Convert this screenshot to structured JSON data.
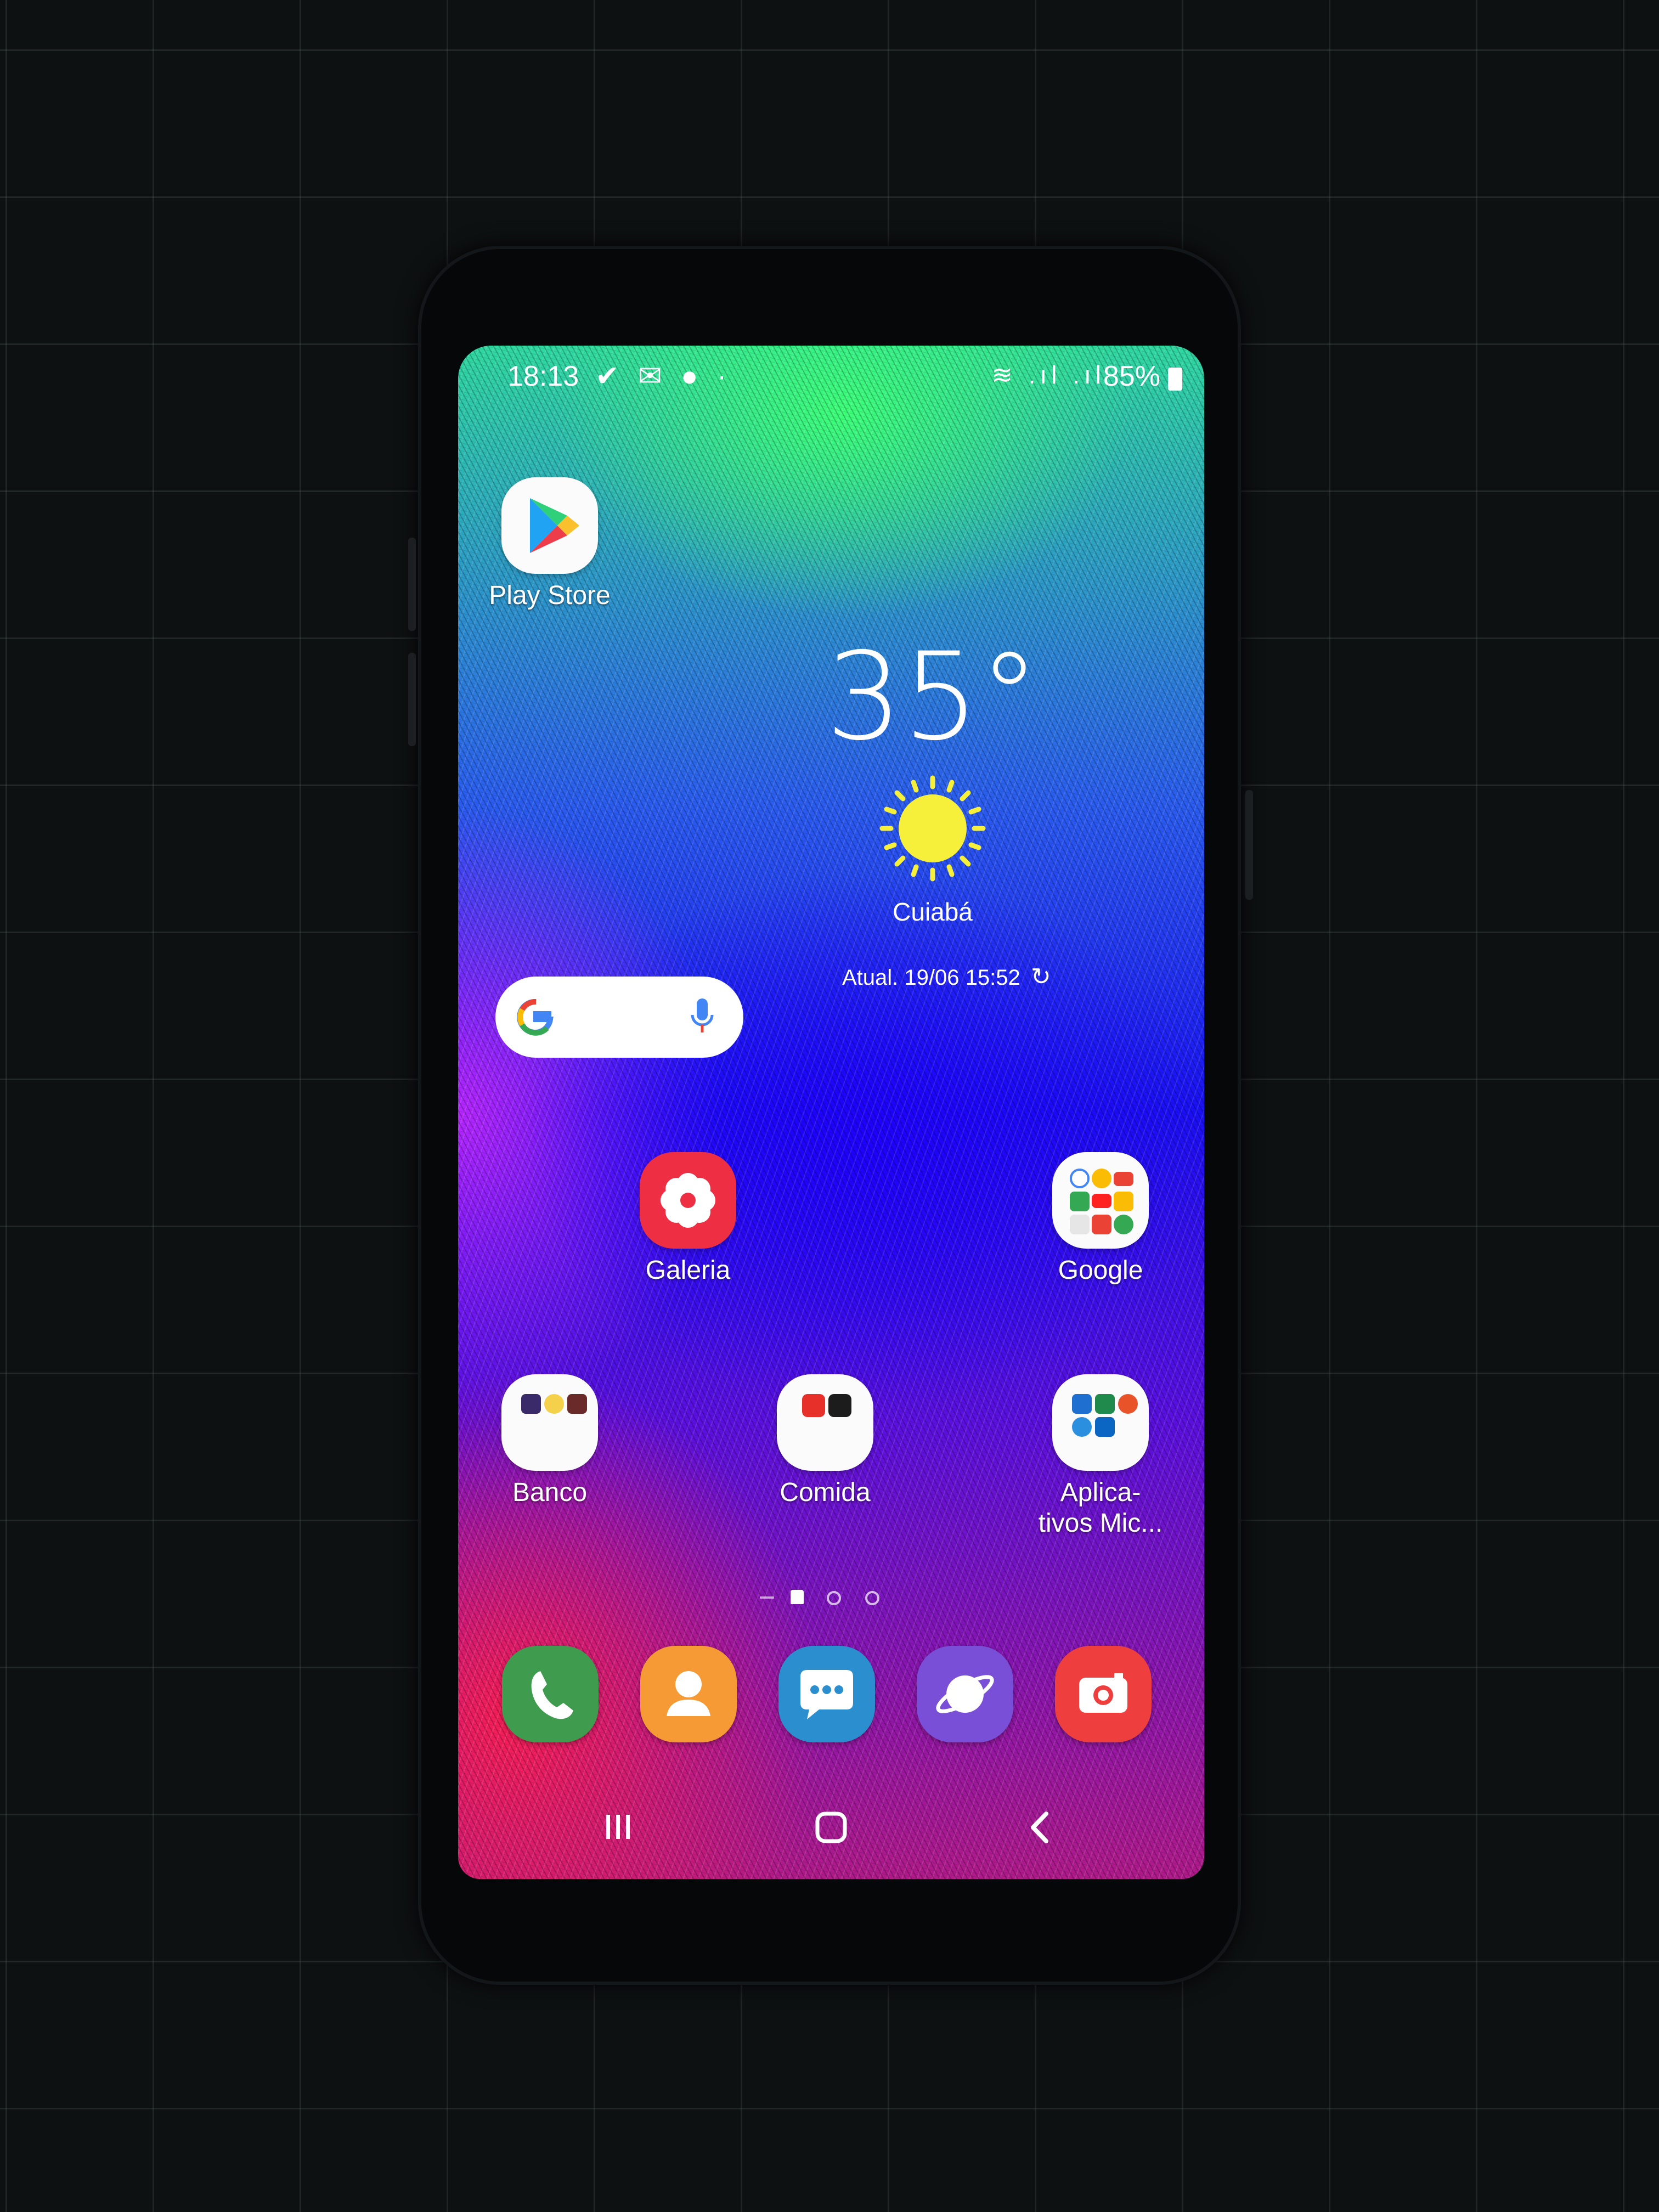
{
  "status_bar": {
    "time": "18:13",
    "left_icons": "✔ ✉ ● ·",
    "right_icons": "≋ .ıl .ıl",
    "battery": "85%"
  },
  "apps": {
    "play_store": "Play Store",
    "galeria": "Galeria",
    "google": "Google",
    "banco": "Banco",
    "comida": "Comida",
    "microsoft": "Aplica-\ntivos Mic..."
  },
  "weather": {
    "temperature": "35°",
    "city": "Cuiabá",
    "updated": "Atual. 19/06 15:52"
  },
  "icons": {
    "play_store": "play-store-icon",
    "galeria": "flower-icon",
    "google_folder": "folder-icon",
    "weather": "sun-icon",
    "search": "google-g-icon",
    "mic": "mic-icon",
    "refresh": "refresh-icon",
    "dock": [
      "phone-icon",
      "contacts-icon",
      "messages-icon",
      "internet-icon",
      "camera-icon"
    ],
    "nav": [
      "recents-icon",
      "home-icon",
      "back-icon"
    ]
  },
  "colors": {
    "phone_green": "#3f9b4e",
    "contacts_orange": "#f59a35",
    "messages_blue": "#2b8fcf",
    "internet_purple": "#7a4fd8",
    "camera_red": "#ee3e3e",
    "galeria_red": "#ee2f43",
    "sun_yellow": "#f6f03a"
  },
  "pager": {
    "pages": 3,
    "current": 1
  }
}
